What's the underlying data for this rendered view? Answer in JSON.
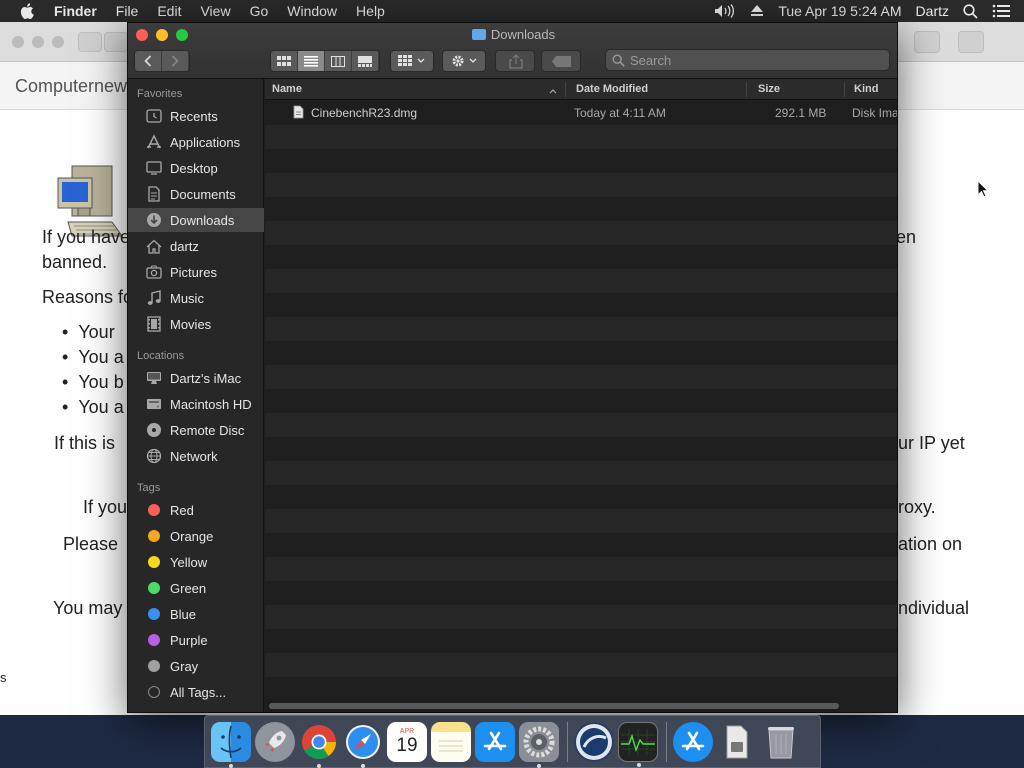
{
  "menubar": {
    "app": "Finder",
    "items": [
      "File",
      "Edit",
      "View",
      "Go",
      "Window",
      "Help"
    ],
    "clock": "Tue Apr 19  5:24 AM",
    "user": "Dartz"
  },
  "browser": {
    "tab_title": "Computernew",
    "lines": [
      "If you have",
      "en",
      "banned.",
      "Reasons fo",
      "Your",
      "You a",
      "You b",
      "You a",
      "If this is",
      "ur IP yet",
      "If you",
      "roxy.",
      "Please",
      "ation on",
      "You may",
      "ndividual",
      "s"
    ]
  },
  "finder": {
    "title": "Downloads",
    "search_placeholder": "Search",
    "sidebar": {
      "favorites_label": "Favorites",
      "favorites": [
        "Recents",
        "Applications",
        "Desktop",
        "Documents",
        "Downloads",
        "dartz",
        "Pictures",
        "Music",
        "Movies"
      ],
      "locations_label": "Locations",
      "locations": [
        "Dartz's iMac",
        "Macintosh HD",
        "Remote Disc",
        "Network"
      ],
      "tags_label": "Tags",
      "tags": [
        {
          "name": "Red",
          "color": "#fc5f57"
        },
        {
          "name": "Orange",
          "color": "#f5a623"
        },
        {
          "name": "Yellow",
          "color": "#f8d81c"
        },
        {
          "name": "Green",
          "color": "#4cd964"
        },
        {
          "name": "Blue",
          "color": "#3a8ff0"
        },
        {
          "name": "Purple",
          "color": "#b45fe6"
        },
        {
          "name": "Gray",
          "color": "#a0a0a0"
        }
      ],
      "all_tags": "All Tags..."
    },
    "columns": {
      "name": "Name",
      "date": "Date Modified",
      "size": "Size",
      "kind": "Kind"
    },
    "files": [
      {
        "name": "CinebenchR23.dmg",
        "date": "Today at 4:11 AM",
        "size": "292.1 MB",
        "kind": "Disk Ima"
      }
    ]
  },
  "dock": {
    "apps": [
      "finder-icon",
      "launchpad-icon",
      "chrome-icon",
      "safari-icon",
      "calendar-icon",
      "notes-icon",
      "app-store-icon",
      "system-preferences-icon",
      "cinema4d-icon",
      "activity-monitor-icon",
      "app-store-downloads-icon",
      "documents-folder-icon",
      "trash-icon"
    ],
    "calendar_month": "APR",
    "calendar_day": "19"
  }
}
